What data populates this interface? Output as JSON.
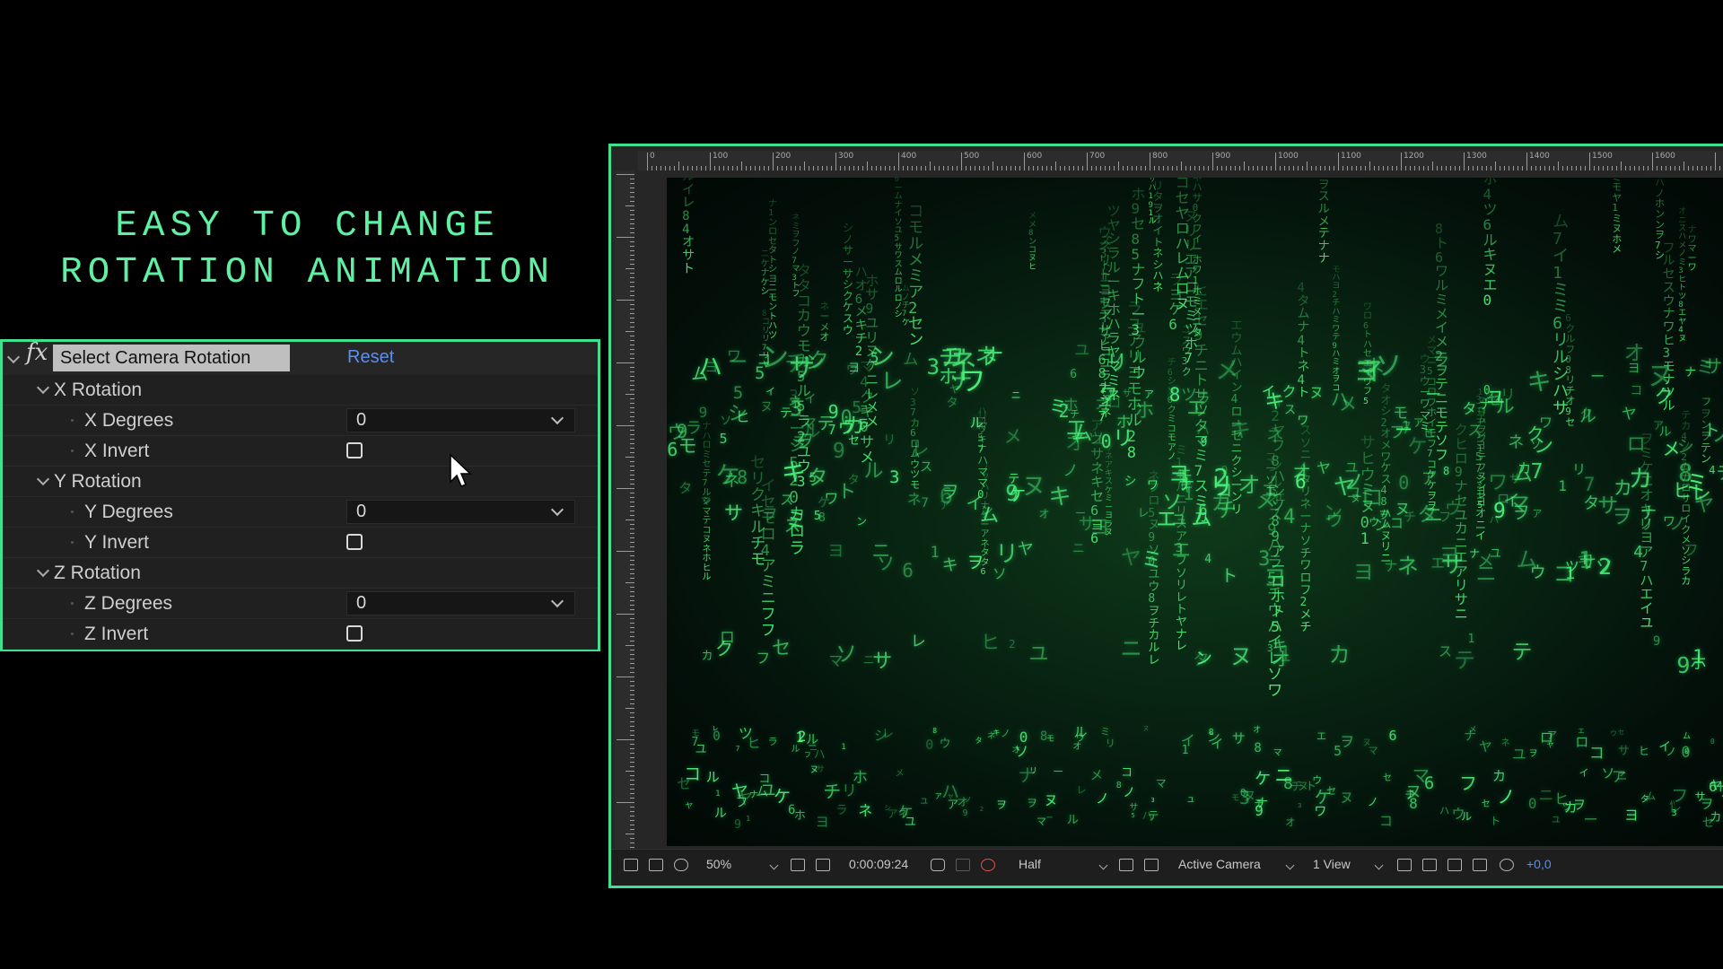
{
  "headline": {
    "line1": "EASY TO CHANGE",
    "line2": "ROTATION ANIMATION",
    "color": "#5ff0a4"
  },
  "effect_panel": {
    "fx_badge": "fx",
    "effect_name": "Select Camera Rotation",
    "reset_label": "Reset",
    "groups": [
      {
        "label": "X Rotation",
        "degrees_label": "X Degrees",
        "degrees_value": "0",
        "invert_label": "X Invert",
        "invert_checked": false
      },
      {
        "label": "Y Rotation",
        "degrees_label": "Y Degrees",
        "degrees_value": "0",
        "invert_label": "Y Invert",
        "invert_checked": false
      },
      {
        "label": "Z Rotation",
        "degrees_label": "Z Degrees",
        "degrees_value": "0",
        "invert_label": "Z Invert",
        "invert_checked": false
      }
    ]
  },
  "viewer": {
    "ruler_labels": [
      "0",
      "100",
      "200",
      "300",
      "400",
      "500",
      "600",
      "700",
      "800",
      "900",
      "1000",
      "1100",
      "1200",
      "1300",
      "1400",
      "1500",
      "1600"
    ],
    "toolbar": {
      "magnification": "50%",
      "timecode": "0:00:09:24",
      "resolution": "Half",
      "camera": "Active Camera",
      "view_layout": "1 View",
      "exposure": "+0,0"
    },
    "accent_color": "#3fe08f",
    "rain_color": "#4cf07a"
  }
}
